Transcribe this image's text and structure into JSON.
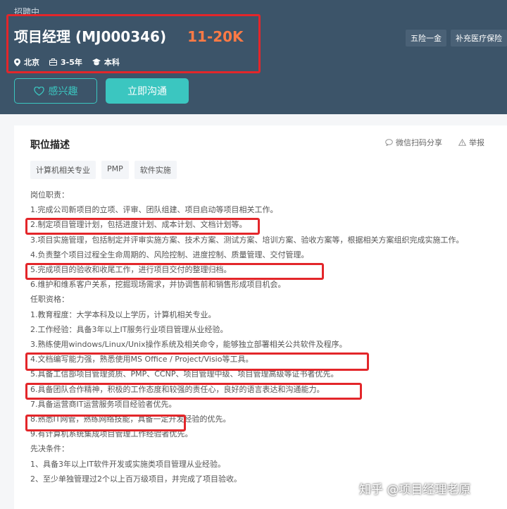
{
  "header": {
    "status": "招聘中",
    "job_title": "项目经理 (MJ000346)",
    "salary": "11-20K",
    "meta": [
      {
        "icon": "location-icon",
        "label": "北京"
      },
      {
        "icon": "briefcase-icon",
        "label": "3-5年"
      },
      {
        "icon": "graduation-cap-icon",
        "label": "本科"
      }
    ],
    "benefits": [
      "五险一金",
      "补充医疗保险"
    ],
    "interest_label": "感兴趣",
    "chat_label": "立即沟通"
  },
  "card": {
    "section_title": "职位描述",
    "share_label": "微信扫码分享",
    "report_label": "举报",
    "skills": [
      "计算机相关专业",
      "PMP",
      "软件实施"
    ],
    "lines": [
      "岗位职责：",
      "1.完成公司新项目的立项、评审、团队组建、项目启动等项目相关工作。",
      "2.制定项目管理计划，包括进度计划、成本计划、文档计划等。",
      "3.项目实施管理，包括制定并评审实施方案、技术方案、测试方案、培训方案、验收方案等，根据相关方案组织完成实施工作。",
      "4.负责整个项目过程全生命周期的、风险控制、进度控制、质量管理、交付管理。",
      "5.完成项目的验收和收尾工作，进行项目交付的整理归档。",
      "6.维护和维系客户关系，挖掘现场需求，并协调售前和销售形成项目机会。",
      "任职资格：",
      "1.教育程度：大学本科及以上学历，计算机相关专业。",
      "2.工作经验：具备3年以上IT服务行业项目管理从业经验。",
      "3.熟练使用windows/Linux/Unix操作系统及相关命令，能够独立部署相关公共软件及程序。",
      "4.文档编写能力强，熟悉使用MS Office / Project/Visio等工具。",
      "5.具备工信部项目管理资质、PMP、CCNP、项目管理中级、项目管理高级等证书者优先。",
      "6.具备团队合作精神，积极的工作态度和较强的责任心，良好的语言表达和沟通能力。",
      "7.具备运营商IT运营服务项目经验者优先。",
      "8.熟悉IT网管，熟练网络技能，具备一定开发经验的优先。",
      "9.有计算机系统集成项目管理工作经验者优先。",
      "先决条件：",
      "1、具备3年以上IT软件开发或实施类项目管理从业经验。",
      "2、至少单独管理过2个以上百万级项目，并完成了项目验收。"
    ]
  },
  "watermark": "知乎 @项目经理老原",
  "colors": {
    "header_bg": "#3c5469",
    "accent": "#3bc6c0",
    "salary": "#fd7a45",
    "highlight": "#e3262a"
  }
}
